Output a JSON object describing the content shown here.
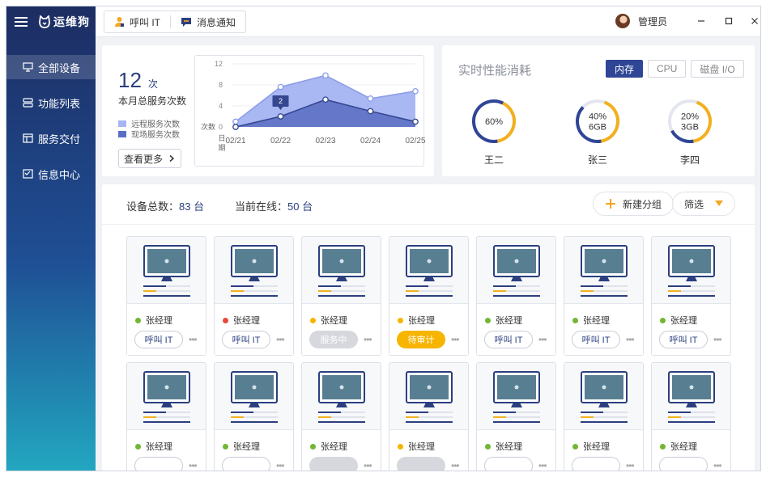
{
  "app": {
    "brand": "运维狗"
  },
  "sidebar": {
    "items": [
      {
        "label": "全部设备",
        "icon": "monitor-icon",
        "active": true
      },
      {
        "label": "功能列表",
        "icon": "list-icon",
        "active": false
      },
      {
        "label": "服务交付",
        "icon": "delivery-icon",
        "active": false
      },
      {
        "label": "信息中心",
        "icon": "message-icon",
        "active": false
      }
    ]
  },
  "topbar": {
    "call_it_label": "呼叫 IT",
    "notify_label": "消息通知",
    "user_name": "管理员"
  },
  "stats": {
    "count": "12",
    "count_unit": "次",
    "count_label": "本月总服务次数",
    "legend_remote": "远程服务次数",
    "legend_onsite": "现场服务次数",
    "more_label": "查看更多"
  },
  "chart_data": {
    "type": "area",
    "x": [
      "02/21",
      "02/22",
      "02/23",
      "02/24",
      "02/25"
    ],
    "series": [
      {
        "name": "远程服务次数",
        "values": [
          1,
          7.6,
          9.8,
          5.4,
          6.8
        ],
        "color": "#9fb0f2"
      },
      {
        "name": "现场服务次数",
        "values": [
          0,
          2,
          5.2,
          3,
          1
        ]
      }
    ],
    "yticks": [
      0,
      4,
      8,
      12
    ],
    "ylim": [
      0,
      12
    ],
    "ylabel": "次数",
    "xlabel": "日期",
    "annotation": {
      "x": "02/22",
      "text": "2"
    }
  },
  "perf": {
    "title": "实时性能消耗",
    "tabs": [
      "内存",
      "CPU",
      "磁盘 I/O"
    ],
    "active_tab": 0,
    "gauges": [
      {
        "name": "王二",
        "lines": [
          "60%"
        ],
        "percent": 60
      },
      {
        "name": "张三",
        "lines": [
          "40%",
          "6GB"
        ],
        "percent": 40
      },
      {
        "name": "李四",
        "lines": [
          "20%",
          "3GB"
        ],
        "percent": 20
      }
    ]
  },
  "devices": {
    "total_label": "设备总数：",
    "total_value": "83 台",
    "online_label": "当前在线：",
    "online_value": "50 台",
    "new_group_label": "新建分组",
    "filter_label": "筛选",
    "colors": {
      "online": "#73b633",
      "offline": "#e84a3a",
      "busy": "#f7b500"
    },
    "cards": [
      {
        "user": "张经理",
        "status": "online",
        "button": "呼叫 IT",
        "btype": "call"
      },
      {
        "user": "张经理",
        "status": "offline",
        "button": "呼叫 IT",
        "btype": "call"
      },
      {
        "user": "张经理",
        "status": "busy",
        "button": "服务中",
        "btype": "busy"
      },
      {
        "user": "张经理",
        "status": "busy",
        "button": "待审计",
        "btype": "audit"
      },
      {
        "user": "张经理",
        "status": "online",
        "button": "呼叫 IT",
        "btype": "call"
      },
      {
        "user": "张经理",
        "status": "online",
        "button": "呼叫 IT",
        "btype": "call"
      },
      {
        "user": "张经理",
        "status": "online",
        "button": "呼叫 IT",
        "btype": "call"
      },
      {
        "user": "张经理",
        "status": "online",
        "button": "",
        "btype": "call"
      },
      {
        "user": "张经理",
        "status": "online",
        "button": "",
        "btype": "call"
      },
      {
        "user": "张经理",
        "status": "online",
        "button": "",
        "btype": "busy"
      },
      {
        "user": "张经理",
        "status": "busy",
        "button": "",
        "btype": "busy"
      },
      {
        "user": "张经理",
        "status": "online",
        "button": "",
        "btype": "call"
      },
      {
        "user": "张经理",
        "status": "online",
        "button": "",
        "btype": "call"
      },
      {
        "user": "张经理",
        "status": "online",
        "button": "",
        "btype": "call"
      }
    ]
  }
}
